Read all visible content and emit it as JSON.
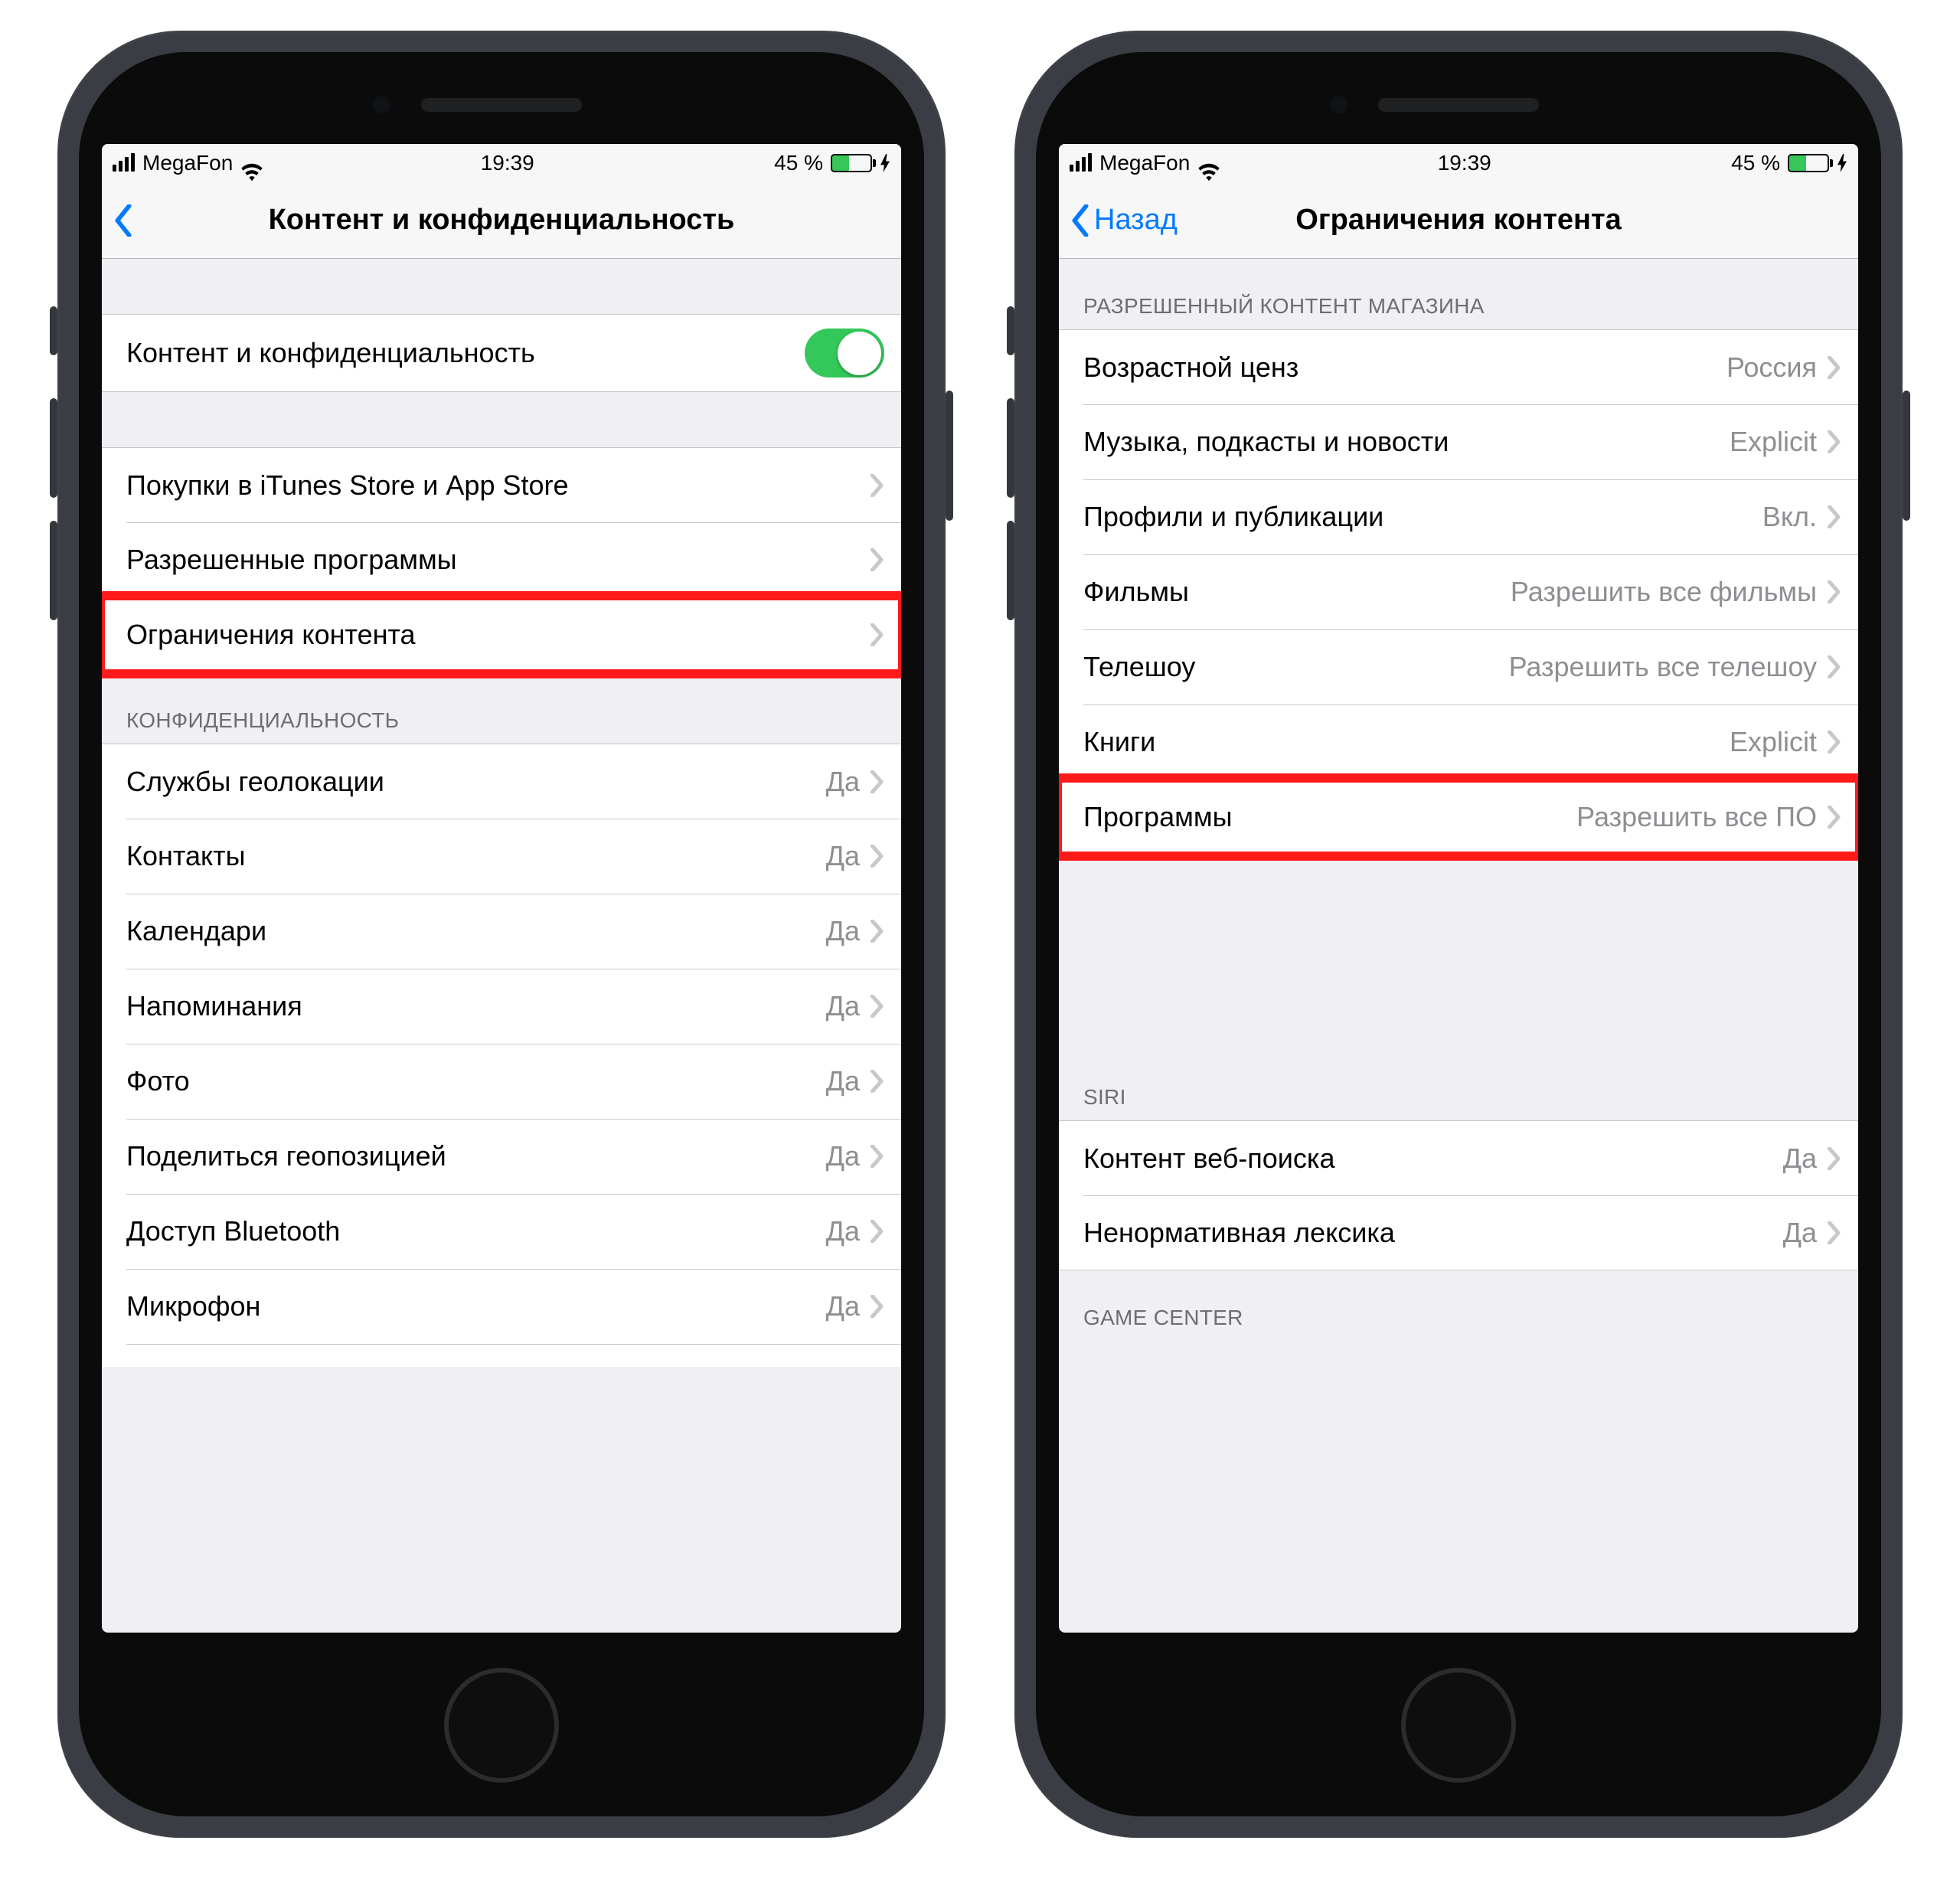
{
  "status": {
    "carrier": "MegaFon",
    "time": "19:39",
    "battery_text": "45 %"
  },
  "phone1": {
    "nav_title": "Контент и конфиденциальность",
    "toggle_label": "Контент и конфиденциальность",
    "group1": {
      "items": [
        {
          "label": "Покупки в iTunes Store и App Store"
        },
        {
          "label": "Разрешенные программы"
        },
        {
          "label": "Ограничения контента"
        }
      ]
    },
    "privacy_header": "КОНФИДЕНЦИАЛЬНОСТЬ",
    "privacy_items": [
      {
        "label": "Службы геолокации",
        "detail": "Да"
      },
      {
        "label": "Контакты",
        "detail": "Да"
      },
      {
        "label": "Календари",
        "detail": "Да"
      },
      {
        "label": "Напоминания",
        "detail": "Да"
      },
      {
        "label": "Фото",
        "detail": "Да"
      },
      {
        "label": "Поделиться геопозицией",
        "detail": "Да"
      },
      {
        "label": "Доступ Bluetooth",
        "detail": "Да"
      },
      {
        "label": "Микрофон",
        "detail": "Да"
      }
    ]
  },
  "phone2": {
    "back_label": "Назад",
    "nav_title": "Ограничения контента",
    "store_header": "РАЗРЕШЕННЫЙ КОНТЕНТ МАГАЗИНА",
    "store_items": [
      {
        "label": "Возрастной ценз",
        "detail": "Россия"
      },
      {
        "label": "Музыка, подкасты и новости",
        "detail": "Explicit"
      },
      {
        "label": "Профили и публикации",
        "detail": "Вкл."
      },
      {
        "label": "Фильмы",
        "detail": "Разрешить все фильмы"
      },
      {
        "label": "Телешоу",
        "detail": "Разрешить все телешоу"
      },
      {
        "label": "Книги",
        "detail": "Explicit"
      },
      {
        "label": "Программы",
        "detail": "Разрешить все ПО"
      }
    ],
    "siri_header": "SIRI",
    "siri_items": [
      {
        "label": "Контент веб-поиска",
        "detail": "Да"
      },
      {
        "label": "Ненормативная лексика",
        "detail": "Да"
      }
    ],
    "gc_header": "GAME CENTER"
  }
}
